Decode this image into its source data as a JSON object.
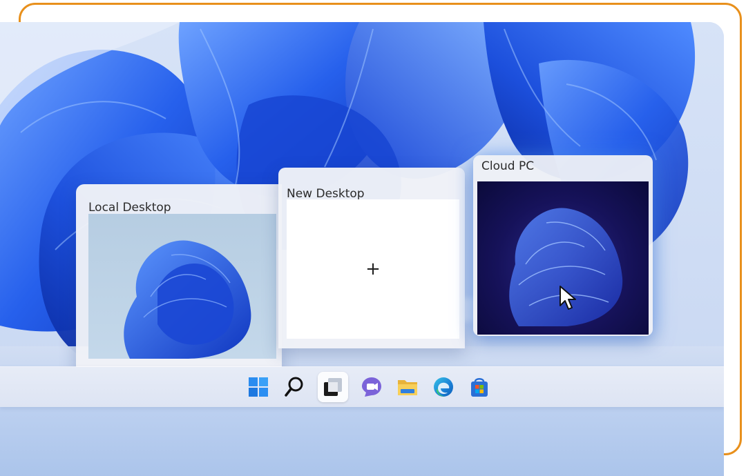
{
  "desktops": {
    "local": {
      "title": "Local Desktop"
    },
    "new": {
      "title": "New Desktop",
      "add_symbol": "+"
    },
    "cloud": {
      "title": "Cloud PC"
    }
  },
  "taskbar": {
    "items": [
      {
        "icon": "windows-start-icon"
      },
      {
        "icon": "search-icon"
      },
      {
        "icon": "task-view-icon",
        "active": true
      },
      {
        "icon": "teams-chat-icon"
      },
      {
        "icon": "file-explorer-icon"
      },
      {
        "icon": "edge-browser-icon"
      },
      {
        "icon": "microsoft-store-icon"
      }
    ]
  },
  "colors": {
    "accent": "#1f5ed8",
    "frame_border": "#e8901c",
    "wallpaper_blue": "#1f55e0"
  }
}
